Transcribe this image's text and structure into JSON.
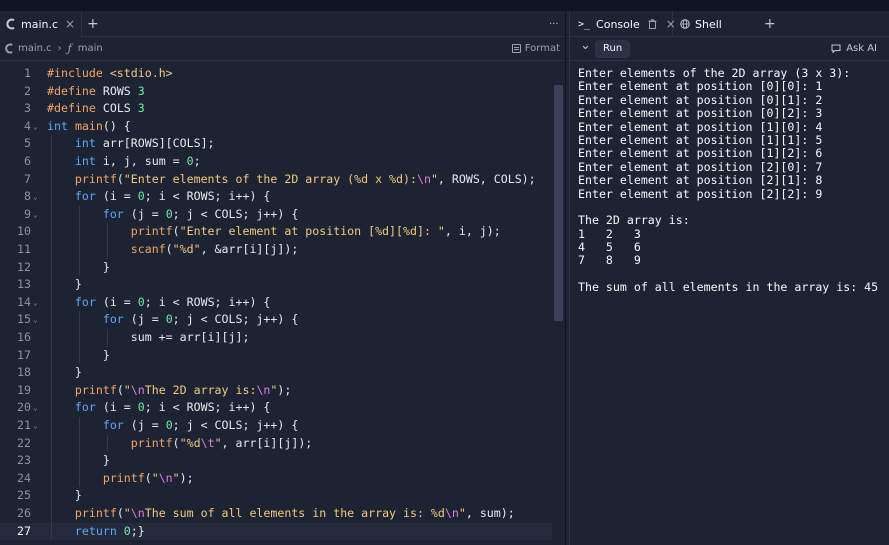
{
  "editor": {
    "tab_label": "main.c",
    "close_glyph": "×",
    "add_glyph": "+",
    "more_glyph": "···",
    "breadcrumb_file": "main.c",
    "breadcrumb_sep": "›",
    "breadcrumb_func_icon": "function-icon",
    "breadcrumb_func": "main",
    "format_label": "Format",
    "current_line": 27,
    "lines": [
      {
        "n": "1",
        "fold": false,
        "html": "<span class='pp'>#include</span> <span class='str'>&lt;stdio.h&gt;</span>"
      },
      {
        "n": "2",
        "fold": false,
        "html": "<span class='pp'>#define</span> ROWS <span class='num'>3</span>"
      },
      {
        "n": "3",
        "fold": false,
        "html": "<span class='pp'>#define</span> COLS <span class='num'>3</span>"
      },
      {
        "n": "4",
        "fold": true,
        "html": "<span class='kw'>int</span> <span class='fn'>main</span>() {"
      },
      {
        "n": "5",
        "fold": false,
        "html": "    <span class='kw'>int</span> arr[ROWS][COLS];"
      },
      {
        "n": "6",
        "fold": false,
        "html": "    <span class='kw'>int</span> i, j, sum = <span class='num'>0</span>;"
      },
      {
        "n": "7",
        "fold": false,
        "html": "    <span class='fn'>printf</span>(<span class='str'>\"Enter elements of the 2D array (%d x %d):</span><span class='esc'>\\n</span><span class='str'>\"</span>, ROWS, COLS);"
      },
      {
        "n": "8",
        "fold": true,
        "html": "    <span class='kw'>for</span> (i = <span class='num'>0</span>; i &lt; ROWS; i++) {"
      },
      {
        "n": "9",
        "fold": true,
        "html": "        <span class='kw'>for</span> (j = <span class='num'>0</span>; j &lt; COLS; j++) {"
      },
      {
        "n": "10",
        "fold": false,
        "html": "            <span class='fn'>printf</span>(<span class='str'>\"Enter element at position [%d][%d]: \"</span>, i, j);"
      },
      {
        "n": "11",
        "fold": false,
        "html": "            <span class='fn'>scanf</span>(<span class='str'>\"%d\"</span>, &amp;arr[i][j]);"
      },
      {
        "n": "12",
        "fold": false,
        "html": "        }"
      },
      {
        "n": "13",
        "fold": false,
        "html": "    }"
      },
      {
        "n": "14",
        "fold": true,
        "html": "    <span class='kw'>for</span> (i = <span class='num'>0</span>; i &lt; ROWS; i++) {"
      },
      {
        "n": "15",
        "fold": true,
        "html": "        <span class='kw'>for</span> (j = <span class='num'>0</span>; j &lt; COLS; j++) {"
      },
      {
        "n": "16",
        "fold": false,
        "html": "            sum += arr[i][j];"
      },
      {
        "n": "17",
        "fold": false,
        "html": "        }"
      },
      {
        "n": "18",
        "fold": false,
        "html": "    }"
      },
      {
        "n": "19",
        "fold": false,
        "html": "    <span class='fn'>printf</span>(<span class='str'>\"</span><span class='esc'>\\n</span><span class='str'>The 2D array is:</span><span class='esc'>\\n</span><span class='str'>\"</span>);"
      },
      {
        "n": "20",
        "fold": true,
        "html": "    <span class='kw'>for</span> (i = <span class='num'>0</span>; i &lt; ROWS; i++) {"
      },
      {
        "n": "21",
        "fold": true,
        "html": "        <span class='kw'>for</span> (j = <span class='num'>0</span>; j &lt; COLS; j++) {"
      },
      {
        "n": "22",
        "fold": false,
        "html": "            <span class='fn'>printf</span>(<span class='str'>\"%d</span><span class='esc'>\\t</span><span class='str'>\"</span>, arr[i][j]);"
      },
      {
        "n": "23",
        "fold": false,
        "html": "        }"
      },
      {
        "n": "24",
        "fold": false,
        "html": "        <span class='fn'>printf</span>(<span class='str'>\"</span><span class='esc'>\\n</span><span class='str'>\"</span>);"
      },
      {
        "n": "25",
        "fold": false,
        "html": "    }"
      },
      {
        "n": "26",
        "fold": false,
        "html": "    <span class='fn'>printf</span>(<span class='str'>\"</span><span class='esc'>\\n</span><span class='str'>The sum of all elements in the array is: %d</span><span class='esc'>\\n</span><span class='str'>\"</span>, sum);"
      },
      {
        "n": "27",
        "fold": false,
        "html": "    <span class='kw'>return</span> <span class='num'>0</span>;}"
      }
    ]
  },
  "console": {
    "console_tab_label": "Console",
    "shell_tab_label": "Shell",
    "close_glyph": "×",
    "add_glyph": "+",
    "collapse_glyph": "⌄",
    "run_label": "Run",
    "ask_ai_label": "Ask AI",
    "output_lines": [
      "Enter elements of the 2D array (3 x 3):",
      "Enter element at position [0][0]: 1",
      "Enter element at position [0][1]: 2",
      "Enter element at position [0][2]: 3",
      "Enter element at position [1][0]: 4",
      "Enter element at position [1][1]: 5",
      "Enter element at position [1][2]: 6",
      "Enter element at position [2][0]: 7",
      "Enter element at position [2][1]: 8",
      "Enter element at position [2][2]: 9",
      "",
      "The 2D array is:",
      "1   2   3",
      "4   5   6",
      "7   8   9",
      "",
      "The sum of all elements in the array is: 45"
    ]
  },
  "colors": {
    "background": "#1c2333",
    "keyword": "#5ea6f7",
    "string": "#f5c97e",
    "number": "#73e8a8",
    "function": "#f5a462"
  }
}
